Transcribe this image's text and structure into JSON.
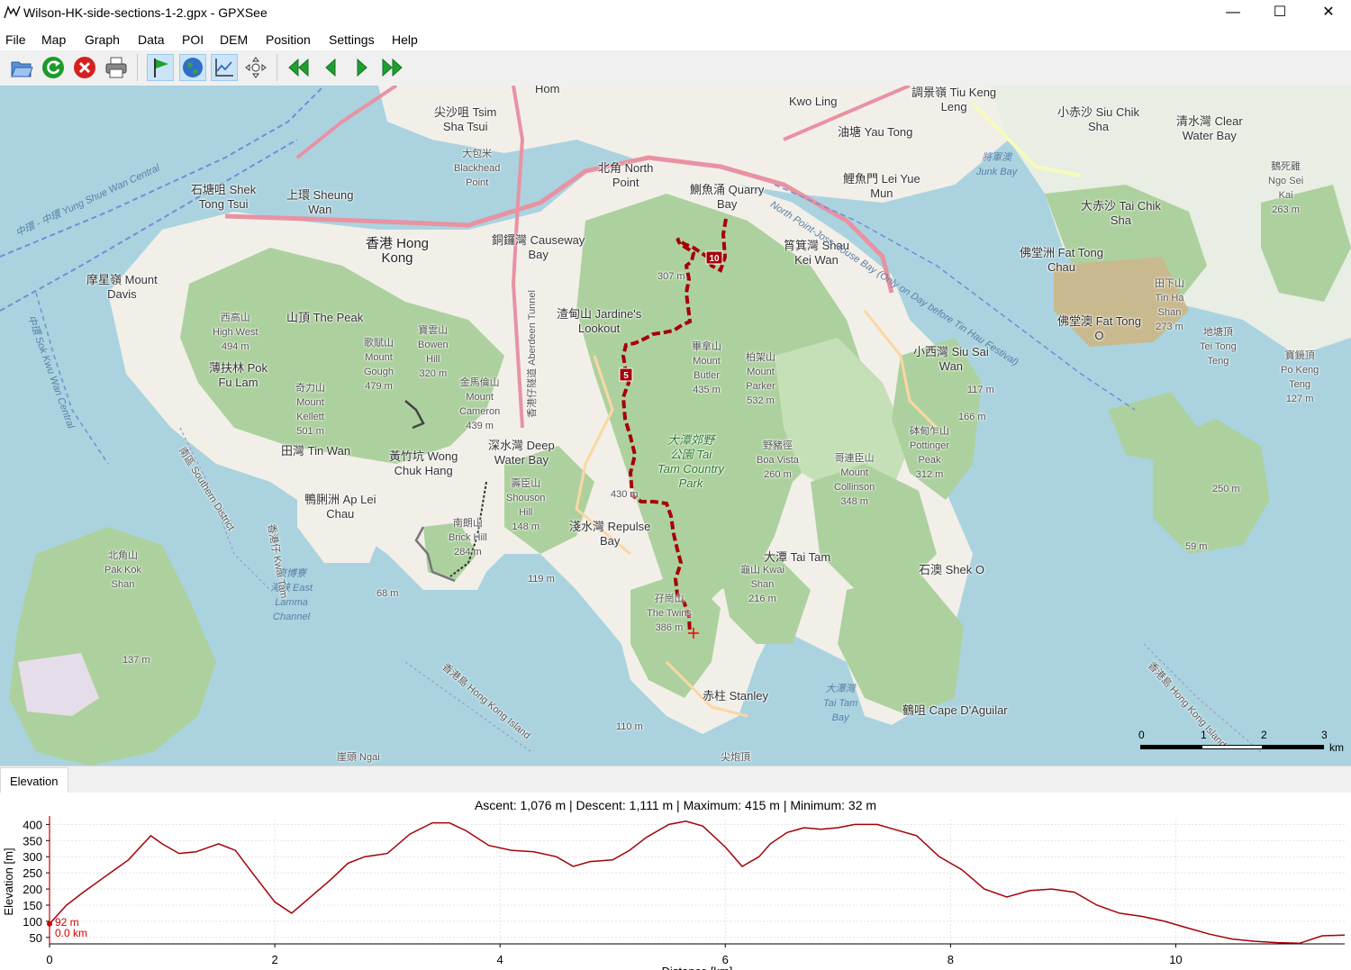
{
  "window": {
    "title": "Wilson-HK-side-sections-1-2.gpx - GPXSee",
    "minimize": "—",
    "maximize": "☐",
    "close": "✕"
  },
  "menu": [
    "File",
    "Map",
    "Graph",
    "Data",
    "POI",
    "DEM",
    "Position",
    "Settings",
    "Help"
  ],
  "toolbar": {
    "buttons": [
      "open-file-icon",
      "reload-icon",
      "close-file-icon",
      "print-icon",
      "show-poi-icon",
      "show-map-icon",
      "show-graphs-icon",
      "show-position-icon",
      "first-file-icon",
      "previous-file-icon",
      "next-file-icon",
      "last-file-icon"
    ]
  },
  "map": {
    "labels": {
      "tsimshatsui": "尖沙咀 Tsim\nSha Tsui",
      "hom": "Hom",
      "blackhead": "大包米\nBlackhead\nPoint",
      "kwunling": "Kwo Ling",
      "tiukeng": "調景嶺 Tiu Keng\nLeng",
      "yautong": "油塘 Yau Tong",
      "siuchik": "小赤沙 Siu Chik\nSha",
      "clearwater": "清水灣 Clear\nWater Bay",
      "ngosei": "鵝死雞\nNgo Sei\nKai\n263 m",
      "northpoint": "北角 North\nPoint",
      "quarrybay": "鰂魚涌 Quarry\nBay",
      "leiyue": "鯉魚門 Lei Yue\nMun",
      "junkbay": "將軍澳\nJunk Bay",
      "taichik": "大赤沙 Tai Chik\nSha",
      "shektong": "石塘咀 Shek\nTong Tsui",
      "sheungwan": "上環 Sheung\nWan",
      "hongkong": "香港 Hong\nKong",
      "causeway": "銅鑼灣 Causeway\nBay",
      "shaukeiwan": "筲箕灣 Shau\nKei Wan",
      "fattong": "佛堂洲 Fat Tong\nChau",
      "fattong2": "佛堂澳 Fat Tong\nO",
      "tinha": "田下山\nTin Ha\nShan\n273 m",
      "mtdavis": "摩星嶺 Mount\nDavis",
      "thepeak": "山頂 The Peak",
      "jardine": "渣甸山 Jardine's\nLookout",
      "highwest": "西高山\nHigh West\n494 m",
      "mtgough": "歌賦山\nMount\nGough\n479 m",
      "bowen": "寶雲山\nBowen\nHill\n320 m",
      "mtbutler": "畢拿山\nMount\nButler\n435 m",
      "mtparker": "柏架山\nMount\nParker\n532 m",
      "saiwan": "小西灣 Siu Sai\nWan",
      "teitong": "地塘頂\nTei Tong\nTeng",
      "pokeng": "寶鏡頂\nPo Keng\nTeng\n127 m",
      "pokfulam": "薄扶林 Pok\nFu Lam",
      "kellett": "奇力山\nMount\nKellett\n501 m",
      "cameron": "金馬倫山\nMount\nCameron\n439 m",
      "taitam": "大潭郊野\n公園 Tai\nTam Country\nPark",
      "boavista": "野豬徑\nBoa Vista\n260 m",
      "collinson": "哥連臣山\nMount\nCollinson\n348 m",
      "pottinger": "砵甸乍山\nPottinger\nPeak\n312 m",
      "m117": "117 m",
      "m166": "166 m",
      "m250": "250 m",
      "m59": "59 m",
      "tinwan": "田灣 Tin Wan",
      "wongchuk": "黃竹坑 Wong\nChuk Hang",
      "deepwater": "深水灣 Deep\nWater Bay",
      "shouson": "壽臣山\nShouson\nHill\n148 m",
      "aplei": "鴨脷洲 Ap Lei\nChau",
      "brick": "南朗山\nBrick Hill\n284 m",
      "m430": "430 m",
      "repulse": "淺水灣 Repulse\nBay",
      "m119": "119 m",
      "m68": "68 m",
      "pakkok": "北角山\nPak Kok\nShan",
      "eastlamma": "東博寮\n海峽 East\nLamma\nChannel",
      "m307": "307 m",
      "taitam2": "大潭 Tai Tam",
      "kwaishan": "龜山 Kwai\nShan\n216 m",
      "shek_o": "石澳 Shek O",
      "twins": "孖崗山\nThe Twins\n386 m",
      "m137": "137 m",
      "stanley": "赤柱 Stanley",
      "taitambay": "大潭灣\nTai Tam\nBay",
      "capedaguilar": "鶴咀 Cape D'Aguilar",
      "m110": "110 m",
      "ngai": "崖頭 Ngai",
      "tsuitau": "尖炮頂",
      "southern": "南區 Southern District",
      "hkisland": "香港島 Hong Kong Island",
      "hkisland2": "香港島 Hong Kong Island",
      "sulphur": "North Point-Joss House Bay (Only on Day before Tin Hau Festival)",
      "aberdeen": "香港仔隧道 Aberdeen Tunnel",
      "central": "香港仔 Kwai Tam",
      "sokkwu": "中環 Sok Kwu Wan Central",
      "yung": "中環 - 中環 Yung Shue Wan Central"
    },
    "waypoints": [
      "5",
      "10"
    ],
    "scale": {
      "labels": [
        "0",
        "1",
        "2",
        "3"
      ],
      "unit": "km"
    }
  },
  "graph": {
    "tab": "Elevation",
    "info": "Ascent: 1,076 m  |  Descent: 1,111 m  |  Maximum: 415 m  |  Minimum: 32 m",
    "ylabel": "Elevation [m]",
    "xlabel": "Distance [km]",
    "marker": {
      "elevation": "92 m",
      "distance": "0.0 km"
    }
  },
  "chart_data": {
    "type": "line",
    "xlabel": "Distance [km]",
    "ylabel": "Elevation [m]",
    "xlim": [
      0,
      11.5
    ],
    "ylim": [
      32,
      415
    ],
    "yticks": [
      50,
      100,
      150,
      200,
      250,
      300,
      350,
      400
    ],
    "xticks": [
      0,
      2,
      4,
      6,
      8,
      10
    ],
    "series": [
      {
        "x": [
          0,
          0.15,
          0.3,
          0.5,
          0.7,
          0.9,
          1.0,
          1.15,
          1.3,
          1.5,
          1.65,
          1.8,
          2.0,
          2.15,
          2.3,
          2.5,
          2.65,
          2.8,
          3.0,
          3.2,
          3.4,
          3.55,
          3.7,
          3.9,
          4.1,
          4.3,
          4.5,
          4.65,
          4.8,
          5.0,
          5.15,
          5.3,
          5.5,
          5.65,
          5.8,
          6.0,
          6.15,
          6.3,
          6.4,
          6.55,
          6.7,
          6.85,
          7.0,
          7.15,
          7.35,
          7.5,
          7.7,
          7.9,
          8.1,
          8.3,
          8.5,
          8.7,
          8.9,
          9.1,
          9.3,
          9.5,
          9.7,
          9.9,
          10.1,
          10.3,
          10.5,
          10.7,
          10.9,
          11.1,
          11.3,
          11.5
        ],
        "y": [
          92,
          150,
          190,
          240,
          290,
          365,
          340,
          310,
          315,
          340,
          320,
          250,
          160,
          125,
          170,
          230,
          280,
          300,
          310,
          370,
          405,
          405,
          380,
          335,
          320,
          315,
          300,
          270,
          285,
          290,
          320,
          360,
          400,
          410,
          395,
          330,
          270,
          300,
          340,
          375,
          390,
          385,
          390,
          400,
          400,
          385,
          365,
          300,
          260,
          200,
          175,
          195,
          200,
          190,
          150,
          125,
          115,
          100,
          80,
          60,
          45,
          38,
          34,
          32,
          55,
          57
        ]
      }
    ]
  }
}
